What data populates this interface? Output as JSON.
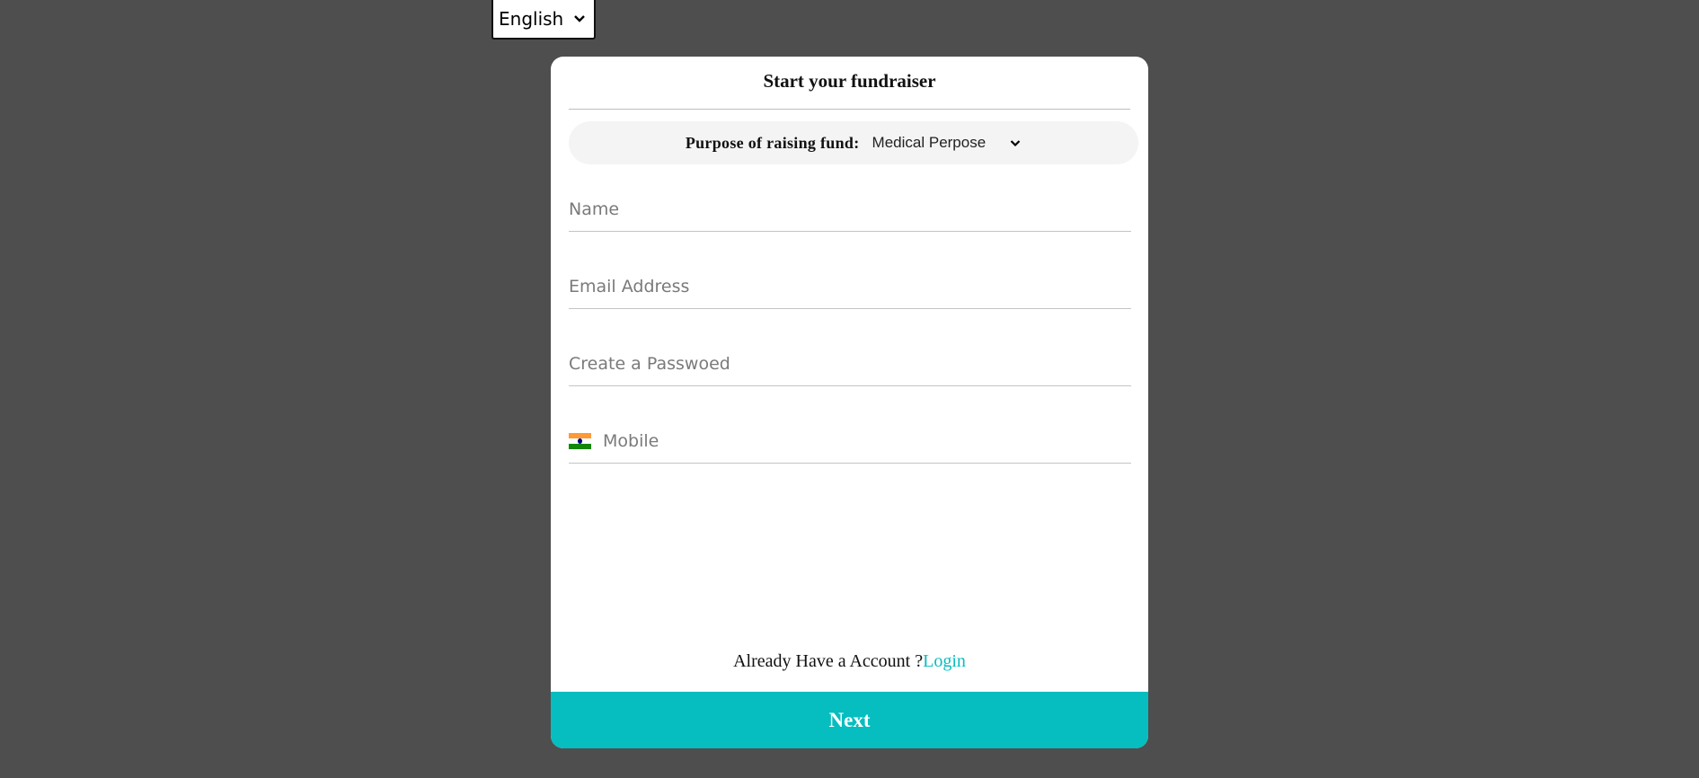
{
  "language": {
    "selected": "English",
    "icon": "chevron-down-icon"
  },
  "form": {
    "title": "Start your fundraiser",
    "purpose": {
      "label": "Purpose of raising fund:",
      "selected": "Medical Perpose",
      "icon": "chevron-down-icon"
    },
    "fields": {
      "name_placeholder": "Name",
      "email_placeholder": "Email Address",
      "password_placeholder": "Create a Passwoed",
      "mobile_placeholder": "Mobile",
      "mobile_flag_icon": "india-flag-icon"
    },
    "account_prompt": "Already Have a Account ?",
    "login_link": "Login",
    "next_label": "Next"
  },
  "colors": {
    "background": "#4e4e4e",
    "accent": "#06bdbf",
    "card": "#ffffff"
  }
}
